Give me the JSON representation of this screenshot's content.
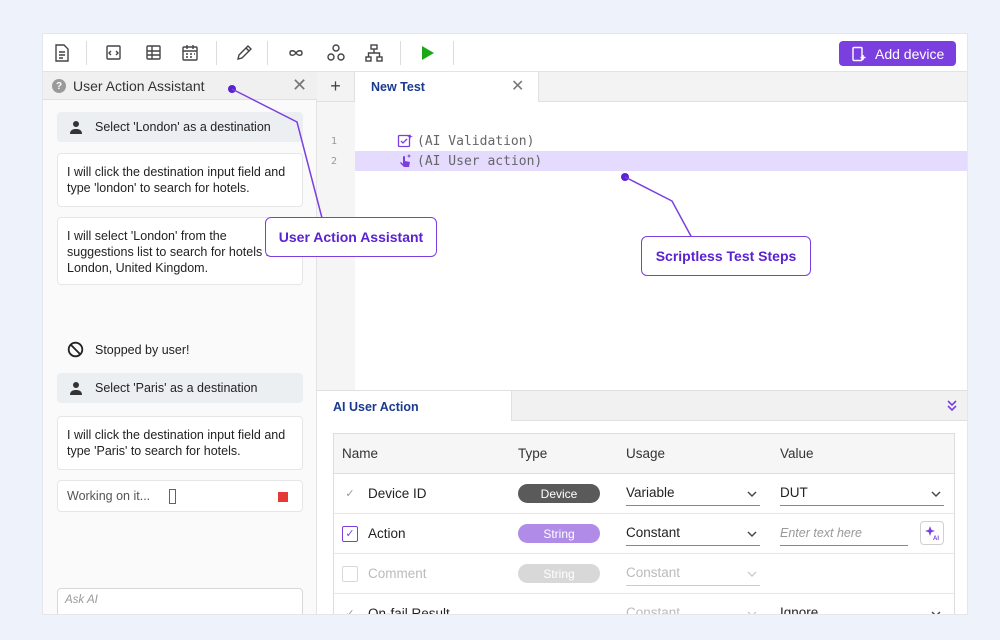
{
  "toolbar": {
    "icons": [
      "new-file-icon",
      "add-code-icon",
      "data-table-icon",
      "calendar-icon",
      "edit-icon",
      "loop-icon",
      "group-icon",
      "hierarchy-icon",
      "play-icon"
    ],
    "add_device_label": "Add device"
  },
  "assistant": {
    "title": "User Action Assistant",
    "messages": [
      {
        "role": "user",
        "text": "Select 'London' as a destination"
      },
      {
        "role": "ai",
        "text": "I will click the destination input field and type 'london' to search for hotels."
      },
      {
        "role": "ai",
        "text": "I will select 'London' from the suggestions list to search for hotels in London, United Kingdom."
      },
      {
        "role": "status",
        "text": "Stopped by user!"
      },
      {
        "role": "user",
        "text": "Select 'Paris' as a destination"
      },
      {
        "role": "ai",
        "text": "I will click the destination input field and type 'Paris' to search for hotels."
      }
    ],
    "working_text": "Working on it...",
    "ask_placeholder": "Ask AI"
  },
  "editor": {
    "add_tab_symbol": "+",
    "tab_title": "New Test",
    "lines": [
      {
        "num": "1",
        "text": "(AI Validation)",
        "icon": "ai-validation-icon"
      },
      {
        "num": "2",
        "text": "(AI User action)",
        "icon": "ai-user-action-icon",
        "highlighted": true
      }
    ]
  },
  "params": {
    "tab_title": "AI User Action",
    "headers": [
      "Name",
      "Type",
      "Usage",
      "Value"
    ],
    "rows": [
      {
        "name": "Device ID",
        "type": "Device",
        "usage": "Variable",
        "value": "DUT",
        "checked": true,
        "enabled": true
      },
      {
        "name": "Action",
        "type": "String",
        "usage": "Constant",
        "value_placeholder": "Enter text here",
        "checked": true,
        "enabled": true
      },
      {
        "name": "Comment",
        "type": "String",
        "usage": "Constant",
        "checked": false,
        "enabled": false
      },
      {
        "name": "On-fail Result",
        "type": "",
        "usage": "Constant",
        "value": "Ignore",
        "checked": true,
        "enabled": true
      }
    ]
  },
  "callouts": {
    "assistant": "User Action Assistant",
    "steps": "Scriptless Test Steps"
  },
  "colors": {
    "accent": "#7b3fe0",
    "device_pill": "#5a5a5a",
    "string_pill": "#b08be8",
    "string_pill_disabled": "#d8d8d8",
    "highlight_row": "#e4dbff",
    "play": "#1aa81a",
    "stop": "#e53935"
  }
}
